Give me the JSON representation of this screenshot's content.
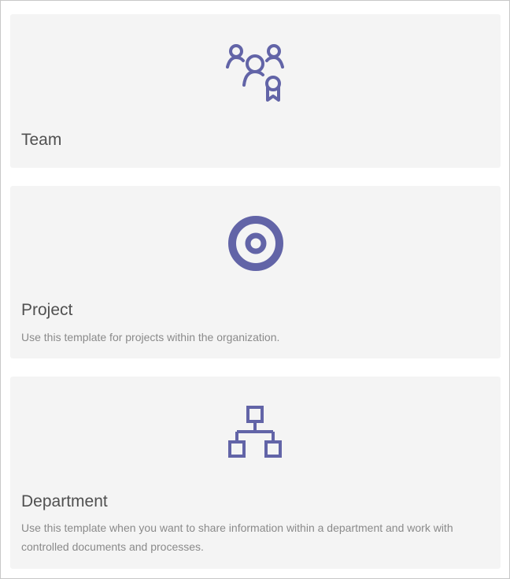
{
  "accent_color": "#6264a7",
  "templates": [
    {
      "title": "Team",
      "description": "",
      "icon": "team-icon"
    },
    {
      "title": "Project",
      "description": "Use this template for projects within the organization.",
      "icon": "target-icon"
    },
    {
      "title": "Department",
      "description": "Use this template when you want to share information within a department and work with controlled documents and processes.",
      "icon": "org-chart-icon"
    }
  ]
}
